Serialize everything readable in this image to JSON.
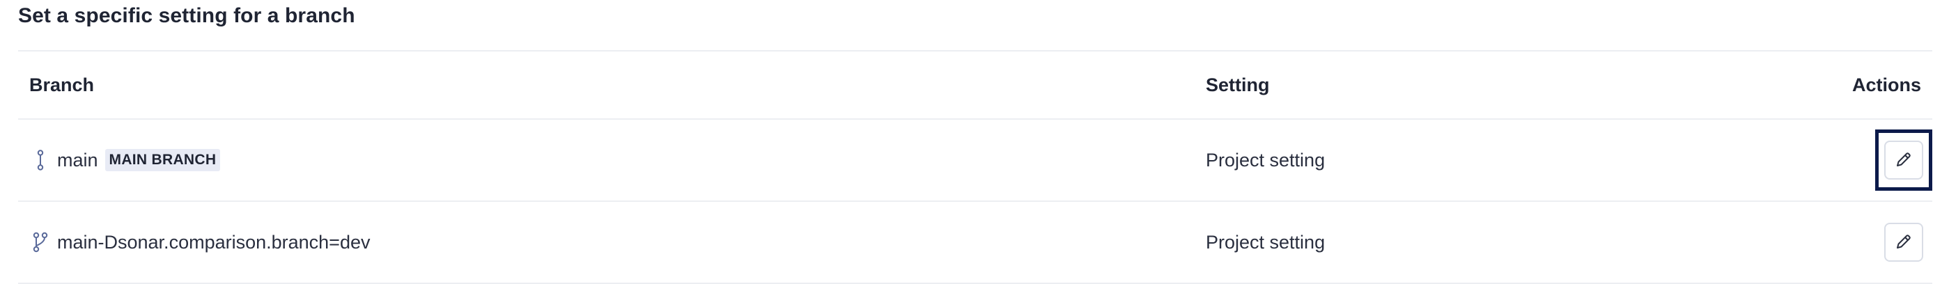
{
  "section": {
    "title": "Set a specific setting for a branch"
  },
  "table": {
    "headers": {
      "branch": "Branch",
      "setting": "Setting",
      "actions": "Actions"
    },
    "rows": [
      {
        "branch": "main",
        "badge": "MAIN BRANCH",
        "icon": "main-branch-icon",
        "setting": "Project setting",
        "action_icon": "pencil-icon",
        "focused": true
      },
      {
        "branch": "main-Dsonar.comparison.branch=dev",
        "badge": "",
        "icon": "git-branch-icon",
        "setting": "Project setting",
        "action_icon": "pencil-icon",
        "focused": false
      }
    ]
  },
  "colors": {
    "focus_ring": "#0c1a4a",
    "badge_bg": "#e8ebf5",
    "divider": "#eceef2"
  }
}
